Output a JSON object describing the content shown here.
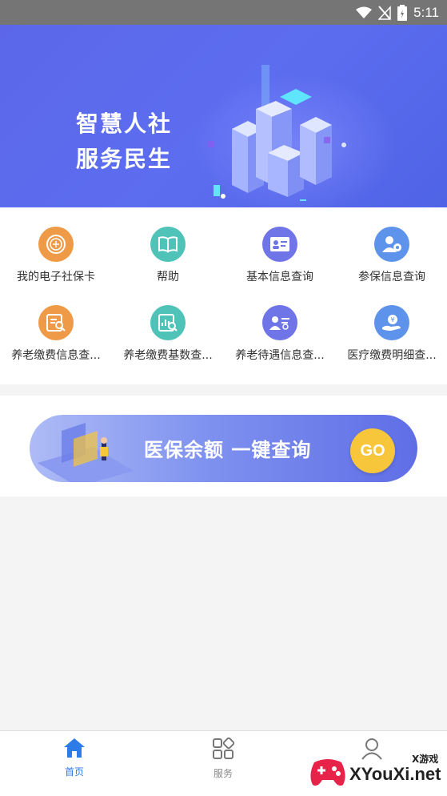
{
  "status_bar": {
    "time": "5:11"
  },
  "banner": {
    "line1": "智慧人社",
    "line2": "服务民生"
  },
  "services": [
    {
      "label": "我的电子社保卡",
      "icon": "social-card-icon",
      "color": "#ef9a47"
    },
    {
      "label": "帮助",
      "icon": "book-icon",
      "color": "#4fc3b8"
    },
    {
      "label": "基本信息查询",
      "icon": "id-card-icon",
      "color": "#6f75e6"
    },
    {
      "label": "参保信息查询",
      "icon": "person-icon",
      "color": "#5e93ec"
    },
    {
      "label": "养老缴费信息查...",
      "icon": "document-search-icon",
      "color": "#ef9a47"
    },
    {
      "label": "养老缴费基数查...",
      "icon": "chart-search-icon",
      "color": "#4fc3b8"
    },
    {
      "label": "养老待遇信息查...",
      "icon": "person-list-icon",
      "color": "#6f75e6"
    },
    {
      "label": "医疗缴费明细查...",
      "icon": "hand-coin-icon",
      "color": "#5e93ec"
    }
  ],
  "promo": {
    "text": "医保余额  一键查询",
    "button": "GO"
  },
  "bottom_nav": [
    {
      "label": "首页",
      "active": true
    },
    {
      "label": "服务",
      "active": false
    },
    {
      "label": "",
      "active": false
    }
  ],
  "watermark": {
    "text": "XYouXi.net",
    "small": "X游戏"
  },
  "colors": {
    "accent": "#2d7be8",
    "banner": "#5b67e8",
    "go_button": "#f7c63b"
  }
}
